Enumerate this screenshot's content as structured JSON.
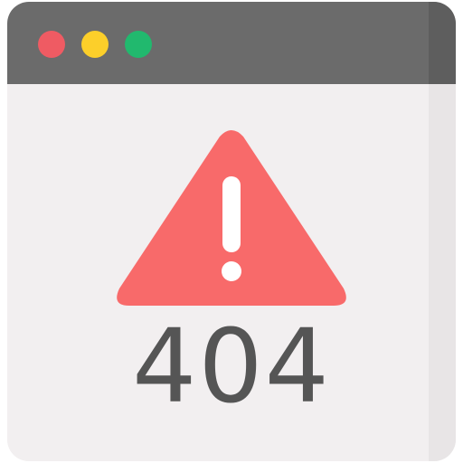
{
  "error": {
    "code": "404"
  },
  "icons": {
    "window": "browser-window-icon",
    "warning": "warning-triangle-icon"
  },
  "colors": {
    "titlebar": "#6b6b6b",
    "window_body": "#f2eff0",
    "dot_red": "#ef5b63",
    "dot_yellow": "#fccf2a",
    "dot_green": "#21b96e",
    "warning_fill": "#f86a6a",
    "exclamation": "#ffffff",
    "code_text": "#555555"
  }
}
